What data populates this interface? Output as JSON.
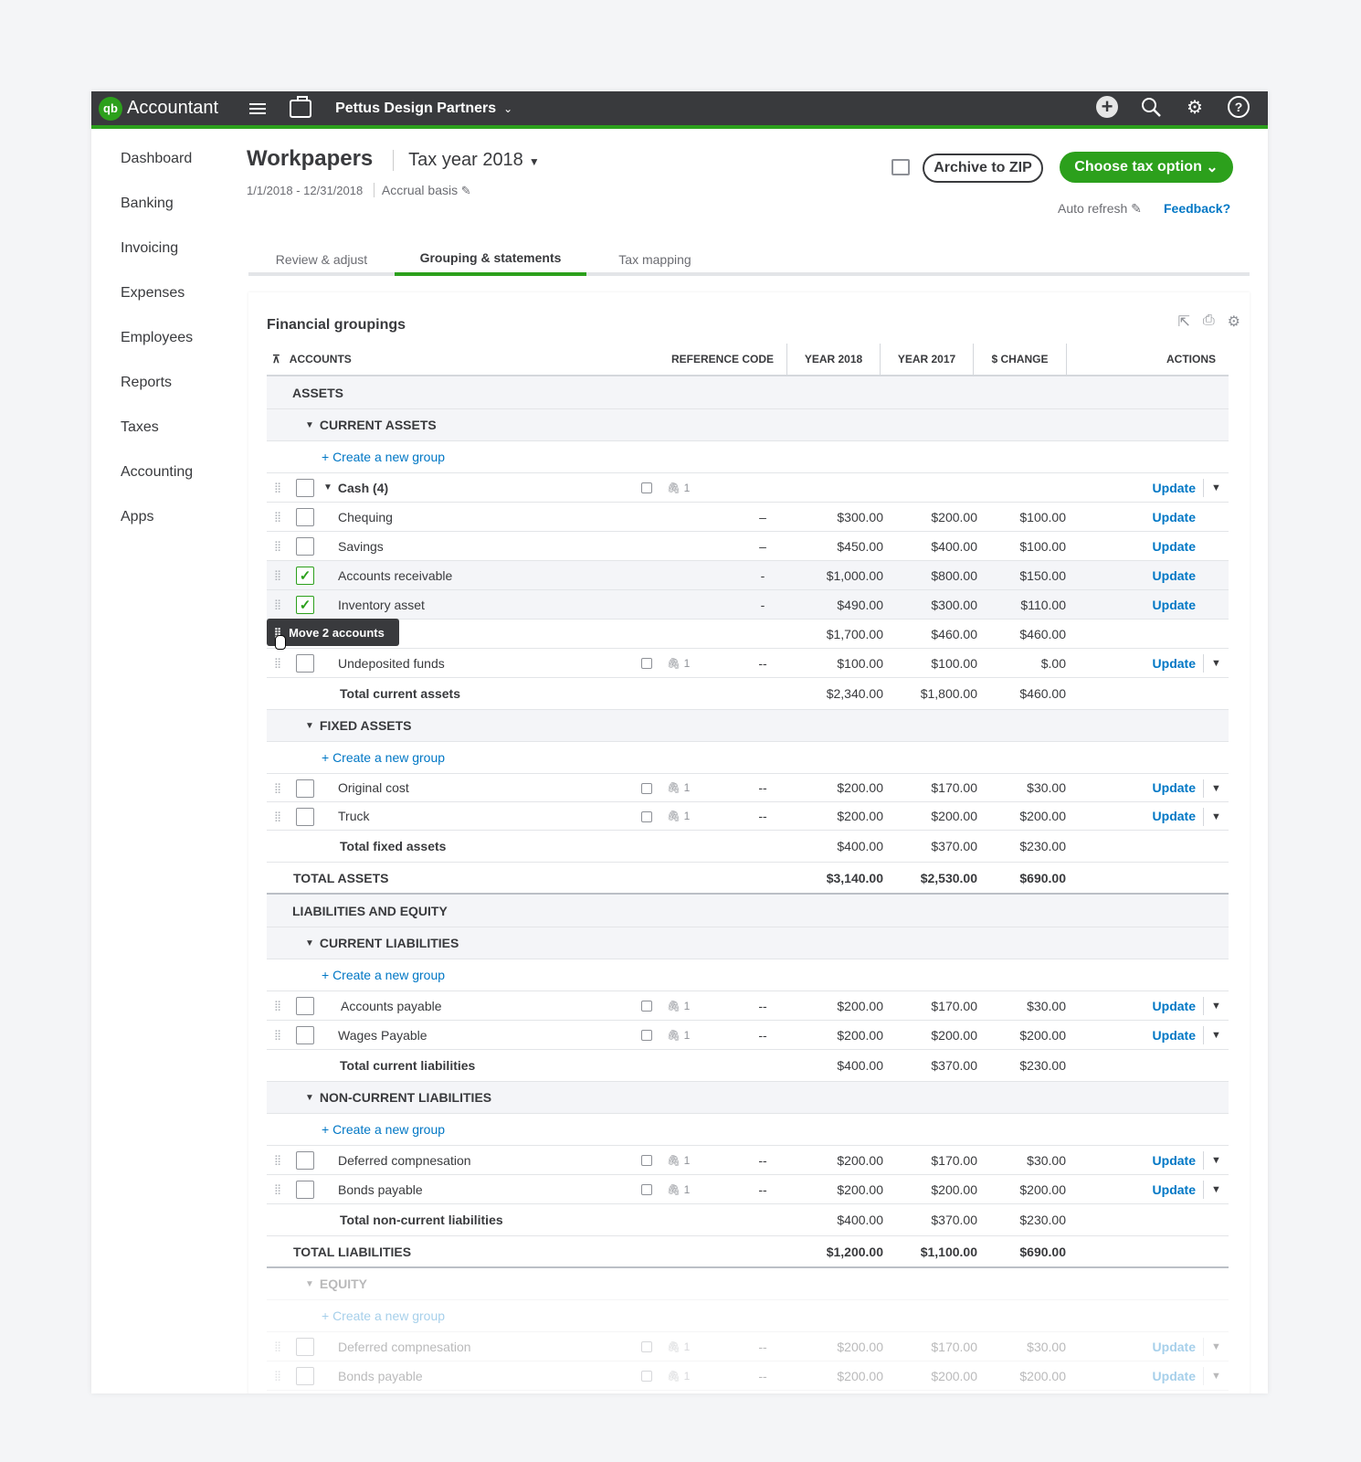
{
  "topbar": {
    "logo_mark": "qb",
    "product": "Accountant",
    "company": "Pettus Design Partners",
    "icons": [
      "menu-icon",
      "briefcase-icon",
      "plus-icon",
      "search-icon",
      "gear-icon",
      "help-icon"
    ]
  },
  "sidebar": {
    "items": [
      {
        "label": "Dashboard"
      },
      {
        "label": "Banking"
      },
      {
        "label": "Invoicing"
      },
      {
        "label": "Expenses"
      },
      {
        "label": "Employees"
      },
      {
        "label": "Reports"
      },
      {
        "label": "Taxes"
      },
      {
        "label": "Accounting"
      },
      {
        "label": "Apps"
      }
    ]
  },
  "header": {
    "title": "Workpapers",
    "tax_year": "Tax year 2018",
    "period": "1/1/2018 - 12/31/2018",
    "basis": "Accrual basis",
    "archive_label": "Archive to ZIP",
    "choose_label": "Choose tax option",
    "auto_refresh": "Auto refresh",
    "feedback": "Feedback?"
  },
  "tabs": [
    {
      "label": "Review & adjust"
    },
    {
      "label": "Grouping & statements"
    },
    {
      "label": "Tax mapping"
    }
  ],
  "panel": {
    "title": "Financial groupings",
    "columns": {
      "accounts": "ACCOUNTS",
      "ref": "REFERENCE CODE",
      "y2018": "YEAR 2018",
      "y2017": "YEAR 2017",
      "change": "$ CHANGE",
      "actions": "ACTIONS"
    },
    "create_label": "+ Create a new group",
    "update_label": "Update",
    "attach_count": "1",
    "assets": "ASSETS",
    "current_assets": "CURRENT ASSETS",
    "cash_group": "Cash (4)",
    "rows_cash": [
      {
        "name": "Chequing",
        "ref": "–",
        "y18": "$300.00",
        "y17": "$200.00",
        "chg": "$100.00"
      },
      {
        "name": "Savings",
        "ref": "–",
        "y18": "$450.00",
        "y17": "$400.00",
        "chg": "$100.00"
      },
      {
        "name": "Accounts receivable",
        "ref": "-",
        "y18": "$1,000.00",
        "y17": "$800.00",
        "chg": "$150.00"
      },
      {
        "name": "Inventory asset",
        "ref": "-",
        "y18": "$490.00",
        "y17": "$300.00",
        "chg": "$110.00"
      }
    ],
    "total_cash": {
      "y18": "$1,700.00",
      "y17": "$460.00",
      "chg": "$460.00"
    },
    "undeposited": {
      "name": "Undeposited funds",
      "ref": "--",
      "y18": "$100.00",
      "y17": "$100.00",
      "chg": "$.00"
    },
    "total_current_assets": {
      "label": "Total current assets",
      "y18": "$2,340.00",
      "y17": "$1,800.00",
      "chg": "$460.00"
    },
    "fixed_assets": "FIXED ASSETS",
    "rows_fixed": [
      {
        "name": "Original cost",
        "ref": "--",
        "y18": "$200.00",
        "y17": "$170.00",
        "chg": "$30.00"
      },
      {
        "name": "Truck",
        "ref": "--",
        "y18": "$200.00",
        "y17": "$200.00",
        "chg": "$200.00"
      }
    ],
    "total_fixed_assets": {
      "label": "Total fixed assets",
      "y18": "$400.00",
      "y17": "$370.00",
      "chg": "$230.00"
    },
    "total_assets": {
      "label": "TOTAL ASSETS",
      "y18": "$3,140.00",
      "y17": "$2,530.00",
      "chg": "$690.00"
    },
    "liab_equity": "LIABILITIES AND EQUITY",
    "current_liabilities": "CURRENT LIABILITIES",
    "rows_cl": [
      {
        "name": "Accounts payable",
        "ref": "--",
        "y18": "$200.00",
        "y17": "$170.00",
        "chg": "$30.00"
      },
      {
        "name": "Wages Payable",
        "ref": "--",
        "y18": "$200.00",
        "y17": "$200.00",
        "chg": "$200.00"
      }
    ],
    "total_cl": {
      "label": "Total current liabilities",
      "y18": "$400.00",
      "y17": "$370.00",
      "chg": "$230.00"
    },
    "noncurrent_liabilities": "NON-CURRENT LIABILITIES",
    "rows_ncl": [
      {
        "name": "Deferred compnesation",
        "ref": "--",
        "y18": "$200.00",
        "y17": "$170.00",
        "chg": "$30.00"
      },
      {
        "name": "Bonds payable",
        "ref": "--",
        "y18": "$200.00",
        "y17": "$200.00",
        "chg": "$200.00"
      }
    ],
    "total_ncl": {
      "label": "Total non-current liabilities",
      "y18": "$400.00",
      "y17": "$370.00",
      "chg": "$230.00"
    },
    "total_liabilities": {
      "label": "TOTAL LIABILITIES",
      "y18": "$1,200.00",
      "y17": "$1,100.00",
      "chg": "$690.00"
    },
    "equity": "EQUITY",
    "rows_eq": [
      {
        "name": "Deferred compnesation",
        "ref": "--",
        "y18": "$200.00",
        "y17": "$170.00",
        "chg": "$30.00"
      },
      {
        "name": "Bonds payable",
        "ref": "--",
        "y18": "$200.00",
        "y17": "$200.00",
        "chg": "$200.00"
      }
    ]
  },
  "tooltip": {
    "label": "Move 2 accounts"
  },
  "colors": {
    "brand_green": "#2ca01c",
    "link_blue": "#0077c5",
    "topbar": "#393a3d"
  }
}
